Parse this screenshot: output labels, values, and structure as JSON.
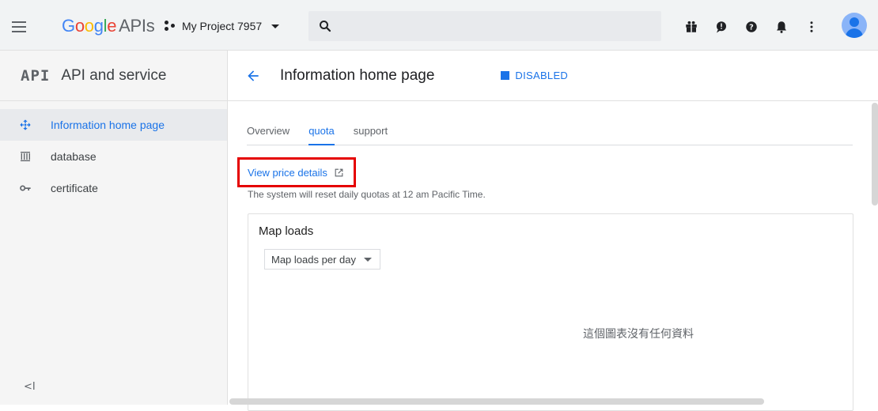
{
  "header": {
    "logo_text": "Google",
    "logo_suffix": "APIs",
    "project_name": "My Project 7957",
    "search_placeholder": "",
    "icons": [
      "gift-icon",
      "feedback-icon",
      "help-icon",
      "notifications-icon",
      "more-vert-icon",
      "avatar"
    ]
  },
  "sidebar": {
    "mark": "API",
    "title": "API and service",
    "items": [
      {
        "label": "Information home page",
        "icon": "dashboard-icon",
        "active": true
      },
      {
        "label": "database",
        "icon": "library-icon",
        "active": false
      },
      {
        "label": "certificate",
        "icon": "key-icon",
        "active": false
      }
    ],
    "collapse_label": "<I"
  },
  "main": {
    "title": "Information home page",
    "status": "DISABLED",
    "tabs": [
      {
        "label": "Overview",
        "active": false
      },
      {
        "label": "quota",
        "active": true
      },
      {
        "label": "support",
        "active": false
      }
    ],
    "price_link": "View price details",
    "reset_note": "The system will reset daily quotas at 12 am Pacific Time.",
    "card": {
      "title": "Map loads",
      "select_value": "Map loads per day",
      "empty_text": "這個圖表沒有任何資料"
    }
  },
  "colors": {
    "accent": "#1a73e8",
    "highlight_border": "#e50000",
    "sidebar_bg": "#f5f5f5",
    "topbar_bg": "#f1f3f4"
  }
}
